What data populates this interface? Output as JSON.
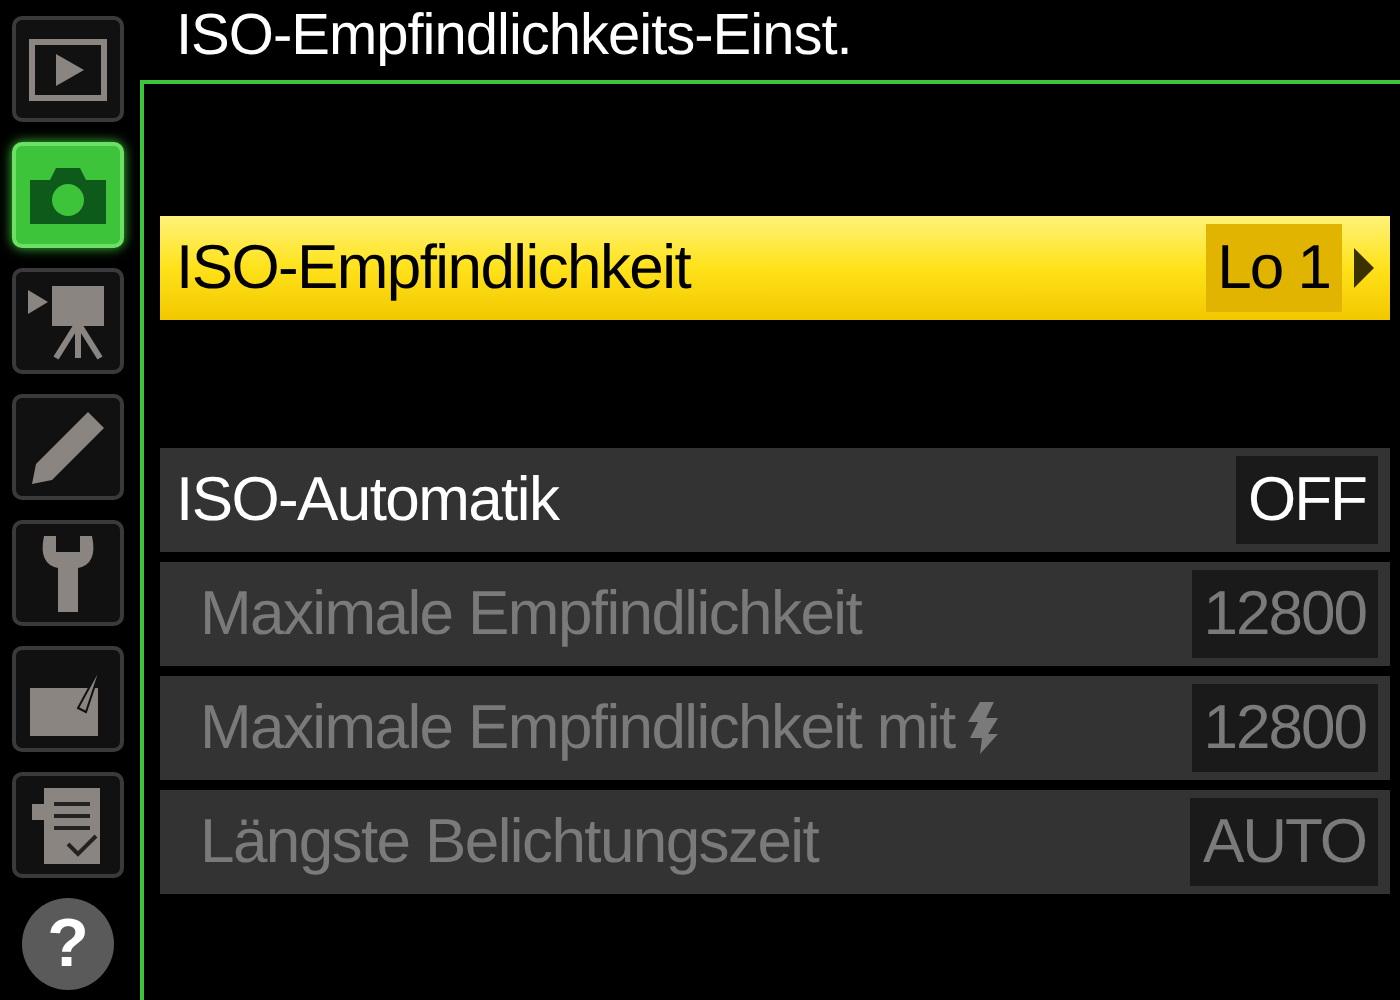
{
  "title": "ISO-Empfindlichkeits-Einst.",
  "tabs": [
    {
      "kind": "playback",
      "selected": false
    },
    {
      "kind": "camera",
      "selected": true
    },
    {
      "kind": "movie",
      "selected": false
    },
    {
      "kind": "pencil",
      "selected": false
    },
    {
      "kind": "wrench",
      "selected": false
    },
    {
      "kind": "retouch",
      "selected": false
    },
    {
      "kind": "recent",
      "selected": false
    },
    {
      "kind": "help",
      "label": "?",
      "selected": false
    }
  ],
  "sections": [
    {
      "items": [
        {
          "label": "ISO-Empfindlichkeit",
          "value": "Lo 1",
          "selected": true,
          "disabled": false,
          "kind": "plain"
        }
      ]
    },
    {
      "items": [
        {
          "label": "ISO-Automatik",
          "value": "OFF",
          "selected": false,
          "disabled": false,
          "kind": "plain"
        },
        {
          "label": "Maximale Empfindlichkeit",
          "value": "12800",
          "selected": false,
          "disabled": true,
          "kind": "plain"
        },
        {
          "label": "Maximale Empfindlichkeit mit",
          "value": "12800",
          "selected": false,
          "disabled": true,
          "kind": "flash"
        },
        {
          "label": "Längste Belichtungszeit",
          "value": "AUTO",
          "selected": false,
          "disabled": true,
          "kind": "plain"
        }
      ]
    }
  ]
}
